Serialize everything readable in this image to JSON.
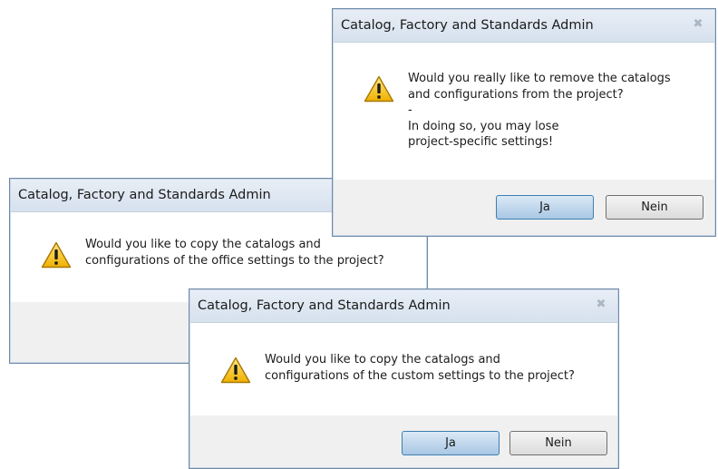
{
  "dialogs": [
    {
      "title": "Catalog, Factory and Standards Admin",
      "message_lines": [
        "Would you like to copy the catalogs and",
        "configurations of the office settings to the project?"
      ],
      "close_symbol": "✖"
    },
    {
      "title": "Catalog, Factory and Standards Admin",
      "message_lines": [
        "Would you really like to remove the catalogs",
        "and configurations from the project?",
        "-",
        "In doing so, you may lose",
        "project-specific settings!"
      ],
      "yes_label": "Ja",
      "no_label": "Nein",
      "close_symbol": "✖"
    },
    {
      "title": "Catalog, Factory and Standards Admin",
      "message_lines": [
        "Would you like to copy the catalogs and",
        "configurations of the custom settings to the project?"
      ],
      "yes_label": "Ja",
      "no_label": "Nein",
      "close_symbol": "✖"
    }
  ],
  "icons": {
    "warning": "warning-icon",
    "close": "close-icon"
  },
  "colors": {
    "title_bar": "#dfe8f2",
    "footer": "#f0f0f0",
    "default_button": "#b9d2ea",
    "warning_yellow": "#f6c21c"
  }
}
